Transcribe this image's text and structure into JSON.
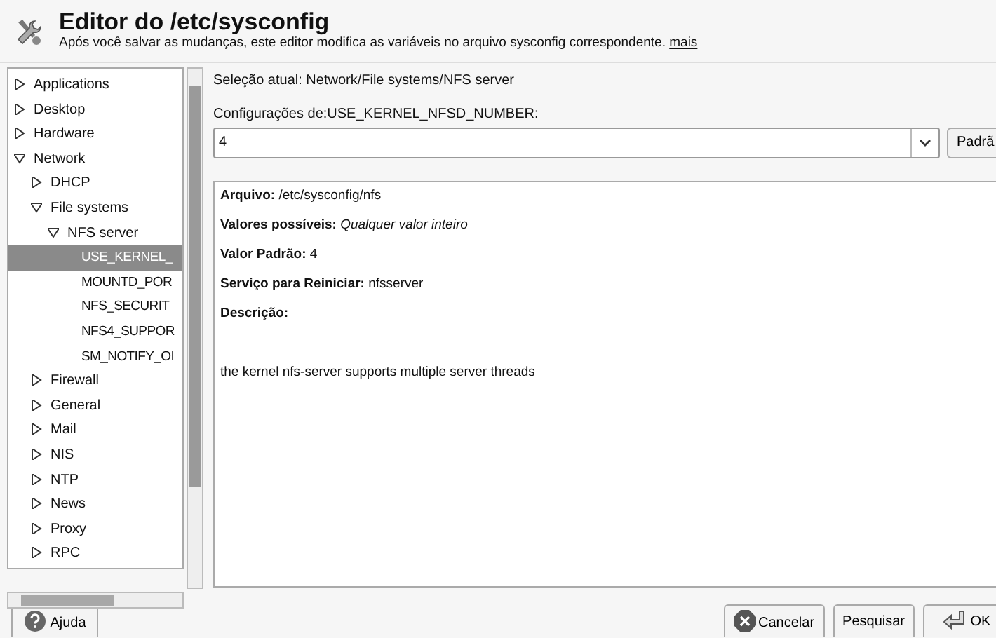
{
  "header": {
    "title": "Editor do /etc/sysconfig",
    "subtitle": "Após você salvar as mudanças, este editor modifica as variáveis no arquivo sysconfig correspondente.",
    "link": "mais"
  },
  "tree": [
    {
      "label": "Applications",
      "expanded": false,
      "selected": false
    },
    {
      "label": "Desktop",
      "expanded": false,
      "selected": false
    },
    {
      "label": "Hardware",
      "expanded": false,
      "selected": false
    },
    {
      "label": "Network",
      "expanded": true,
      "selected": false,
      "children": [
        {
          "label": "DHCP",
          "expanded": false,
          "selected": false
        },
        {
          "label": "File systems",
          "expanded": true,
          "selected": false,
          "children": [
            {
              "label": "NFS server",
              "expanded": true,
              "selected": false,
              "children": [
                {
                  "label": "USE_KERNEL_",
                  "selected": true
                },
                {
                  "label": "MOUNTD_POR",
                  "selected": false
                },
                {
                  "label": "NFS_SECURIT",
                  "selected": false
                },
                {
                  "label": "NFS4_SUPPOR",
                  "selected": false
                },
                {
                  "label": "SM_NOTIFY_OI",
                  "selected": false
                }
              ]
            }
          ]
        },
        {
          "label": "Firewall",
          "expanded": false,
          "selected": false
        },
        {
          "label": "General",
          "expanded": false,
          "selected": false
        },
        {
          "label": "Mail",
          "expanded": false,
          "selected": false
        },
        {
          "label": "NIS",
          "expanded": false,
          "selected": false
        },
        {
          "label": "NTP",
          "expanded": false,
          "selected": false
        },
        {
          "label": "News",
          "expanded": false,
          "selected": false
        },
        {
          "label": "Proxy",
          "expanded": false,
          "selected": false
        },
        {
          "label": "RPC",
          "expanded": false,
          "selected": false
        }
      ]
    }
  ],
  "current_selection": "Seleção atual: Network/File systems/NFS server",
  "setting": {
    "label": "Configurações de:USE_KERNEL_NFSD_NUMBER:",
    "value": "4",
    "default_button": {
      "label": "Padrã"
    }
  },
  "info": [
    "**Arquivo:** /etc/sysconfig/nfs",
    "**Valores possíveis:** *Qualquer valor inteiro*",
    "**Valor Padrão:** 4",
    "**Serviço para Reiniciar:** nfsserver",
    "**Descrição:**"
  ],
  "description": "the kernel nfs-server supports multiple server threads",
  "buttons": [
    {
      "kind": "help",
      "label": "Ajuda"
    },
    {
      "kind": "cancel",
      "label": "Cancelar"
    },
    {
      "kind": "search",
      "label": "Pesquisar"
    },
    {
      "kind": "ok",
      "label": "OK"
    }
  ]
}
